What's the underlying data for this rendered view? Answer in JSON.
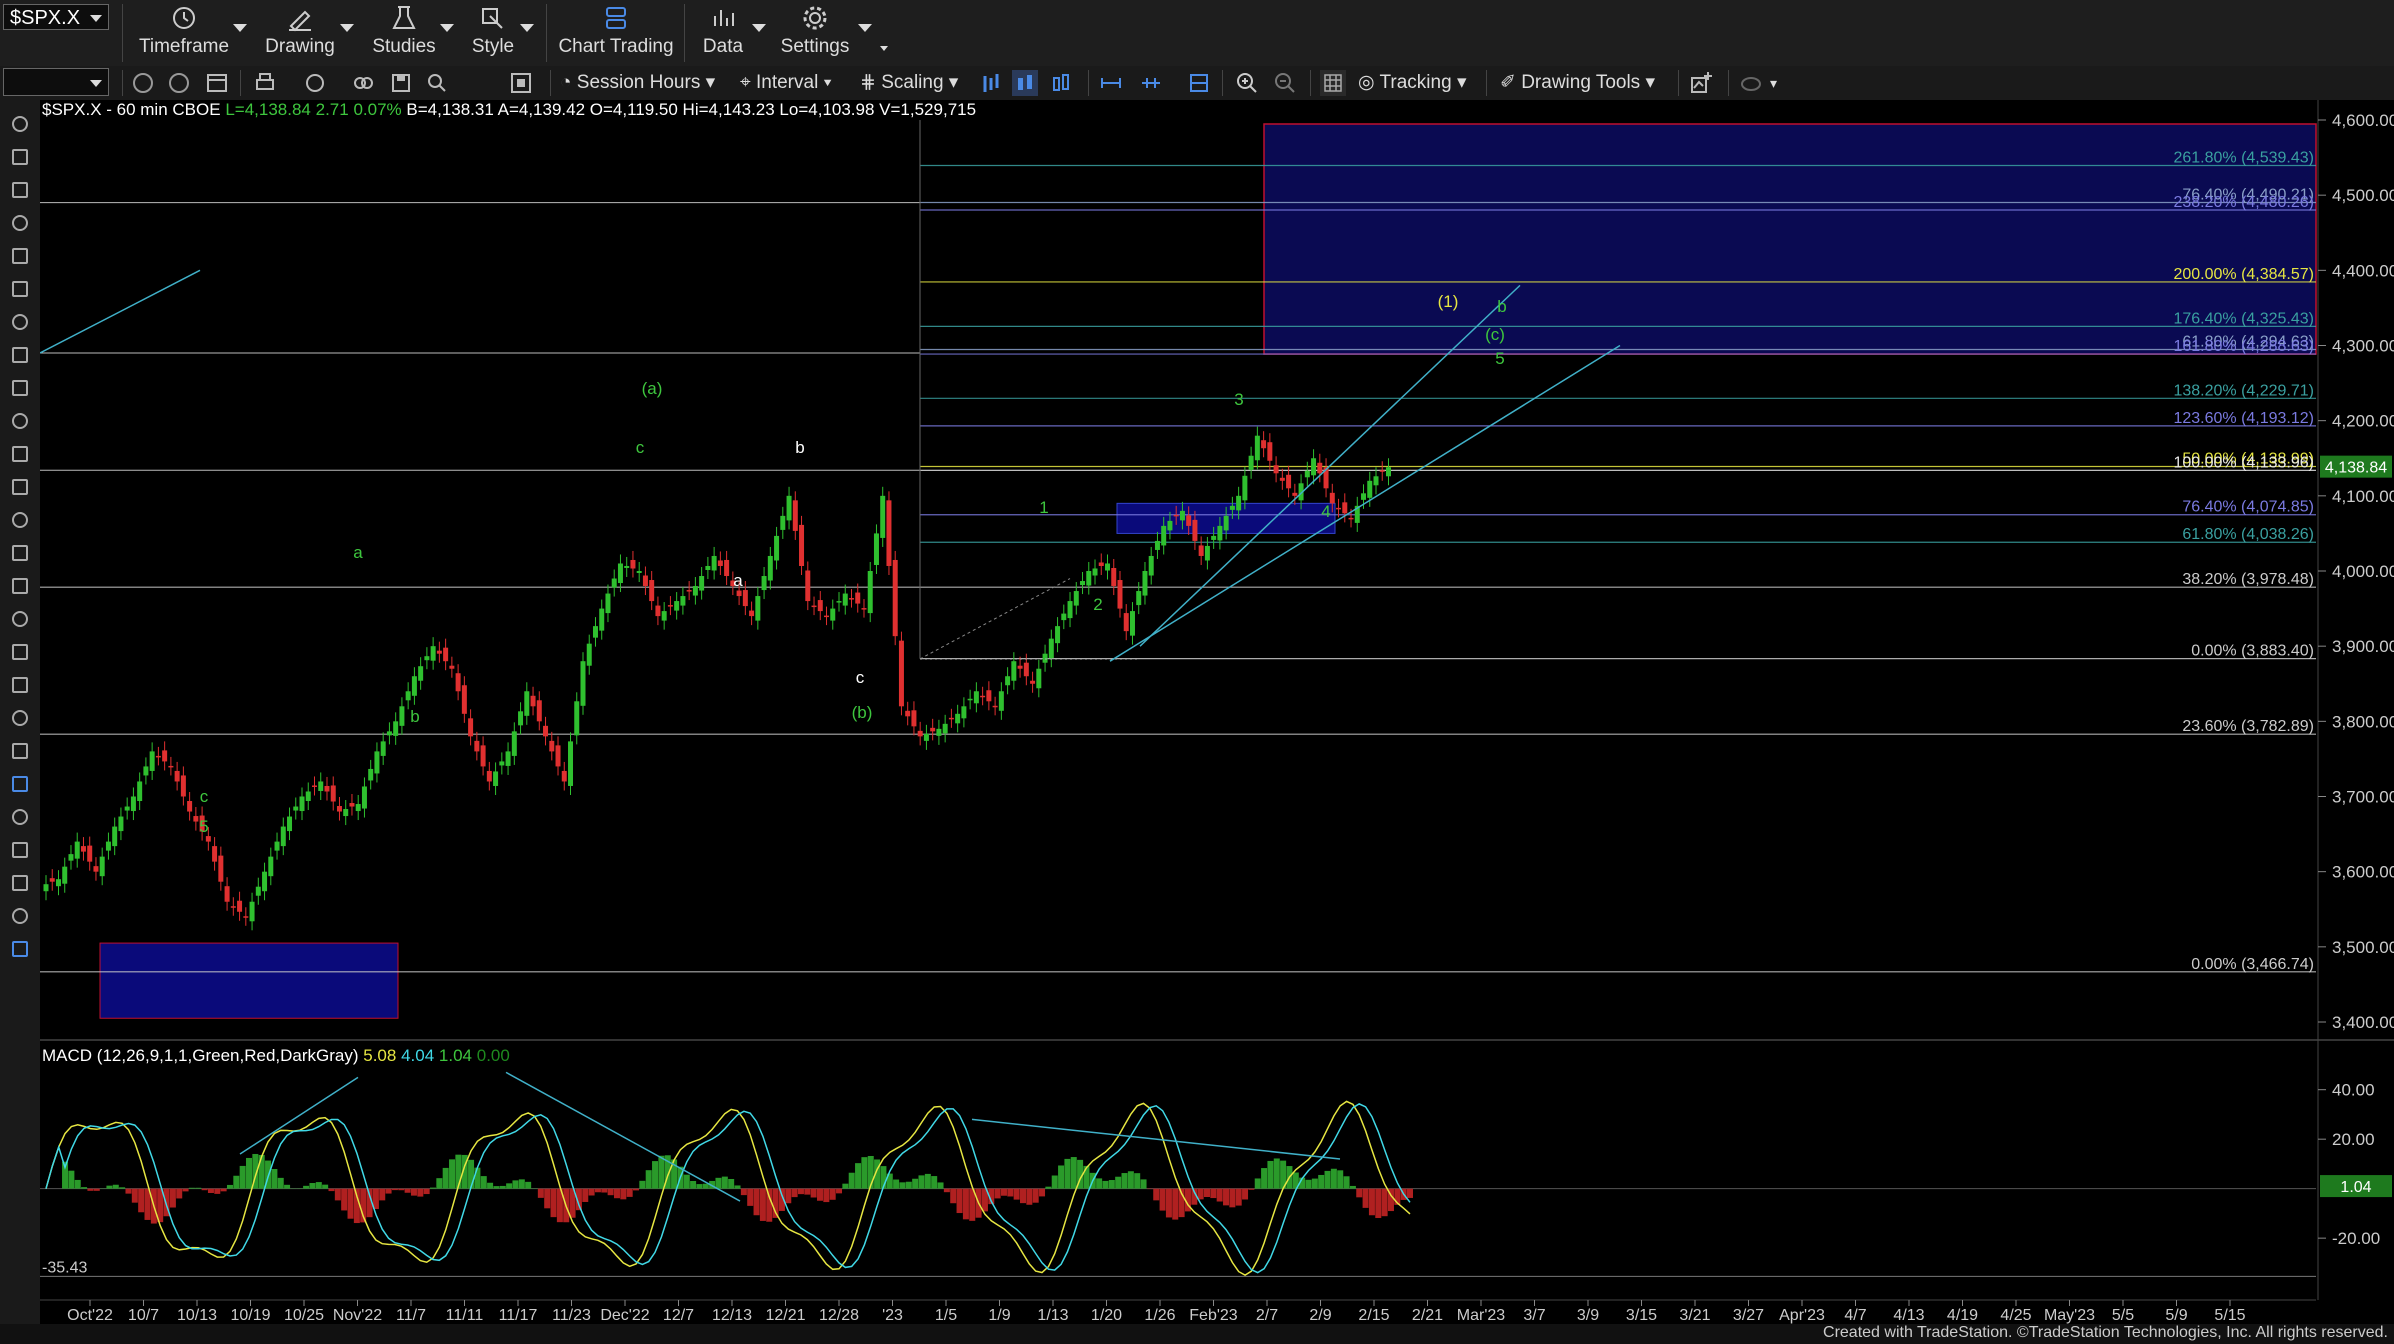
{
  "toolbar": {
    "symbol": "$SPX.X",
    "buttons": [
      {
        "label": "Timeframe",
        "icon": "clock-icon"
      },
      {
        "label": "Drawing",
        "icon": "pen-icon"
      },
      {
        "label": "Studies",
        "icon": "flask-icon"
      },
      {
        "label": "Style",
        "icon": "style-icon"
      },
      {
        "label": "Chart Trading",
        "icon": "chart-trading-icon"
      },
      {
        "label": "Data",
        "icon": "bars-icon"
      },
      {
        "label": "Settings",
        "icon": "gear-icon"
      }
    ]
  },
  "toolbar2": {
    "session_hours": "Session Hours",
    "interval": "Interval",
    "scaling": "Scaling",
    "tracking": "Tracking",
    "drawing_tools": "Drawing Tools"
  },
  "header": {
    "title": "$SPX.X - 60 min  CBOE",
    "last": "L=4,138.84",
    "chg": "2.71",
    "pct": "0.07%",
    "rest": "B=4,138.31  A=4,139.42  O=4,119.50  Hi=4,143.23  Lo=4,103.98  V=1,529,715"
  },
  "macd_header": {
    "name": "MACD (12,26,9,1,1,Green,Red,DarkGray)",
    "v1": "5.08",
    "v2": "4.04",
    "v3": "1.04",
    "v4": "0.00"
  },
  "footer": "Created with TradeStation. ©TradeStation Technologies, Inc. All rights reserved.",
  "colors": {
    "up": "#2fc02f",
    "down": "#e03030",
    "macd_line": "#e6e642",
    "signal": "#40d8e6",
    "fib_box": "#0a0a5a",
    "price_tag": "#1e7a1e"
  },
  "chart_data": {
    "type": "candlestick",
    "y_axis": {
      "ylim": [
        3400,
        4600
      ],
      "ticks": [
        "4,600.00",
        "4,500.00",
        "4,400.00",
        "4,300.00",
        "4,200.00",
        "4,100.00",
        "4,000.00",
        "3,900.00",
        "3,800.00",
        "3,700.00",
        "3,600.00",
        "3,500.00",
        "3,400.00"
      ]
    },
    "last_price_tag": "4,138.84",
    "x_ticks": [
      "Oct'22",
      "10/7",
      "10/13",
      "10/19",
      "10/25",
      "Nov'22",
      "11/7",
      "11/11",
      "11/17",
      "11/23",
      "Dec'22",
      "12/7",
      "12/13",
      "12/21",
      "12/28",
      "'23",
      "1/5",
      "1/9",
      "1/13",
      "1/20",
      "1/26",
      "Feb'23",
      "2/7",
      "2/9",
      "2/15",
      "2/21",
      "Mar'23",
      "3/7",
      "3/9",
      "3/15",
      "3/21",
      "3/27",
      "Apr'23",
      "4/7",
      "4/13",
      "4/19",
      "4/25",
      "May'23",
      "5/5",
      "5/9",
      "5/15"
    ],
    "fib_levels": [
      {
        "label": "261.80% (4,539.43)",
        "value": 4539.43,
        "color": "#3aa0a0"
      },
      {
        "label": "76.40% (4,490.21)",
        "value": 4490.21,
        "color": "#8aa0c8"
      },
      {
        "label": "238.20% (4,480.26)",
        "value": 4480.26,
        "color": "#7a7ae0"
      },
      {
        "label": "200.00% (4,384.57)",
        "value": 4384.57,
        "color": "#e6e642"
      },
      {
        "label": "176.40% (4,325.43)",
        "value": 4325.43,
        "color": "#3aa0a0"
      },
      {
        "label": "61.80% (4,294.63)",
        "value": 4294.63,
        "color": "#8aa0c8"
      },
      {
        "label": "161.80% (4,288.63)",
        "value": 4288.63,
        "color": "#7a7ae0"
      },
      {
        "label": "138.20% (4,229.71)",
        "value": 4229.71,
        "color": "#3aa0a0"
      },
      {
        "label": "123.60% (4,193.12)",
        "value": 4193.12,
        "color": "#7a7ae0"
      },
      {
        "label": "50.00% (4,138.99)",
        "value": 4138.99,
        "color": "#e6e642"
      },
      {
        "label": "100.00% (4,133.96)",
        "value": 4133.96,
        "color": "#ffffff"
      },
      {
        "label": "76.40% (4,074.85)",
        "value": 4074.85,
        "color": "#7a7ae0"
      },
      {
        "label": "61.80% (4,038.26)",
        "value": 4038.26,
        "color": "#3aa0a0"
      },
      {
        "label": "38.20% (3,978.48)",
        "value": 3978.48,
        "color": "#cccccc"
      },
      {
        "label": "0.00% (3,883.40)",
        "value": 3883.4,
        "color": "#cccccc"
      },
      {
        "label": "23.60% (3,782.89)",
        "value": 3782.89,
        "color": "#cccccc"
      },
      {
        "label": "0.00% (3,466.74)",
        "value": 3466.74,
        "color": "#cccccc"
      }
    ],
    "wave_labels": [
      {
        "text": "(a)",
        "color": "#3ec63e"
      },
      {
        "text": "c",
        "color": "#3ec63e"
      },
      {
        "text": "b",
        "color": "#ffffff"
      },
      {
        "text": "a",
        "color": "#3ec63e"
      },
      {
        "text": "a",
        "color": "#ffffff"
      },
      {
        "text": "b",
        "color": "#3ec63e"
      },
      {
        "text": "c",
        "color": "#ffffff"
      },
      {
        "text": "(b)",
        "color": "#3ec63e"
      },
      {
        "text": "c",
        "color": "#3ec63e"
      },
      {
        "text": "5",
        "color": "#3ec63e"
      },
      {
        "text": "1",
        "color": "#3ec63e"
      },
      {
        "text": "2",
        "color": "#3ec63e"
      },
      {
        "text": "3",
        "color": "#3ec63e"
      },
      {
        "text": "4",
        "color": "#3ec63e"
      },
      {
        "text": "(1)",
        "color": "#e6e642"
      },
      {
        "text": "b",
        "color": "#3ec63e"
      },
      {
        "text": "(c)",
        "color": "#3ec63e"
      },
      {
        "text": "5",
        "color": "#3ec63e"
      }
    ],
    "macd": {
      "y_ticks": [
        "40.00",
        "20.00",
        "-20.00"
      ],
      "min_label": "-35.43",
      "hist_tag": "1.04",
      "ylim": [
        -45,
        52
      ]
    },
    "series_close": [
      3590,
      3640,
      3600,
      3660,
      3700,
      3760,
      3740,
      3680,
      3640,
      3560,
      3540,
      3600,
      3660,
      3700,
      3720,
      3680,
      3690,
      3760,
      3800,
      3860,
      3900,
      3870,
      3780,
      3720,
      3760,
      3840,
      3780,
      3720,
      3880,
      3950,
      4010,
      4000,
      3940,
      3960,
      3980,
      4020,
      3980,
      3940,
      4020,
      4100,
      3960,
      3940,
      3970,
      3950,
      4100,
      3820,
      3780,
      3790,
      3810,
      3840,
      3820,
      3880,
      3850,
      3910,
      3960,
      4000,
      4010,
      3920,
      4000,
      4060,
      4080,
      4020,
      4060,
      4100,
      4180,
      4130,
      4100,
      4150,
      4090,
      4070,
      4120,
      4138
    ]
  }
}
